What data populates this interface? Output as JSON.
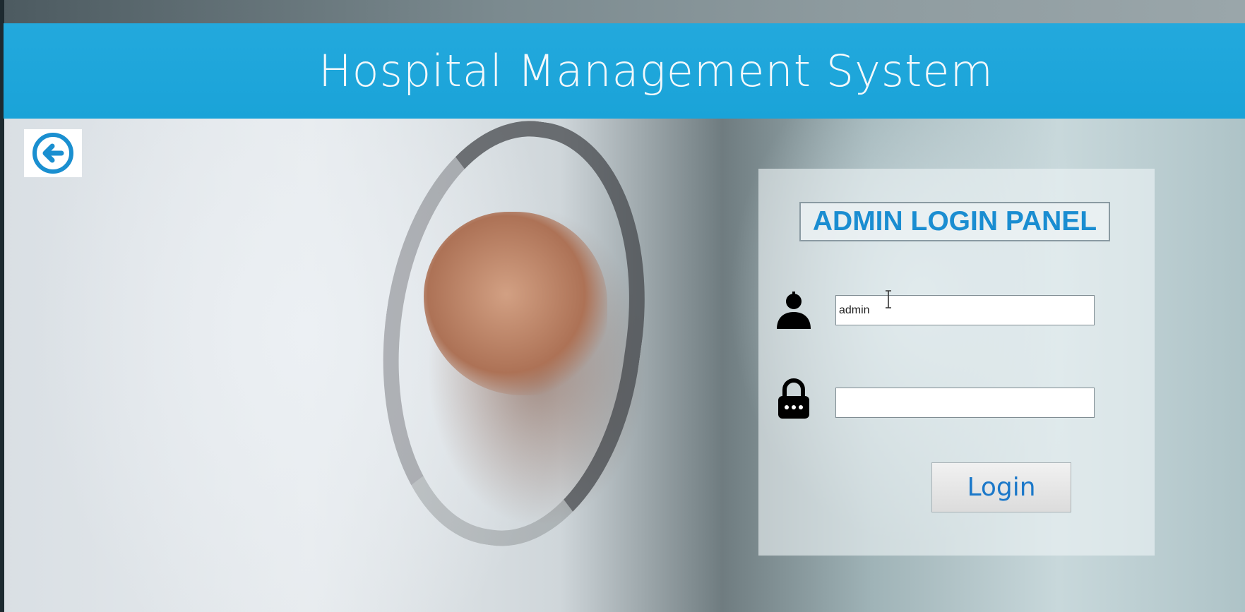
{
  "header": {
    "title": "Hospital Management System"
  },
  "back_button": {
    "icon": "arrow-left-circle-icon"
  },
  "login_panel": {
    "title": "ADMIN LOGIN PANEL",
    "username": {
      "icon": "user-icon",
      "value": "admin"
    },
    "password": {
      "icon": "lock-icon",
      "value": ""
    },
    "login_label": "Login"
  },
  "colors": {
    "header_bg": "#1aa3d8",
    "accent": "#1a8dd1",
    "button_text": "#1b78c9"
  }
}
